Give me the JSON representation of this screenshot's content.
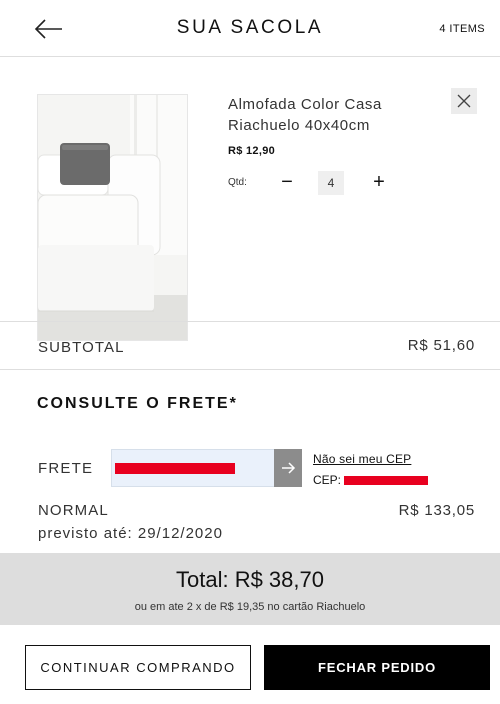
{
  "header": {
    "title": "SUA SACOLA",
    "item_count": "4 ITEMS",
    "back_icon": "arrow-left-icon"
  },
  "cart_item": {
    "name": "Almofada Color Casa Riachuelo 40x40cm",
    "price": "R$ 12,90",
    "qty_label": "Qtd:",
    "quantity": "4",
    "minus_symbol": "−",
    "plus_symbol": "+",
    "image_icon": "product-photo-sofa-with-gray-pillow",
    "remove_icon": "close-icon"
  },
  "summary": {
    "subtotal_label": "SUBTOTAL",
    "subtotal_value": "R$ 51,60"
  },
  "shipping": {
    "title": "CONSULTE O FRETE*",
    "frete_label": "FRETE",
    "dont_know_cep": "Não sei meu CEP",
    "cep_label": "CEP:",
    "method": "NORMAL",
    "method_price": "R$ 133,05",
    "forecast": "previsto até: 29/12/2020",
    "redaction_color": "#e8001f",
    "submit_icon": "arrow-right-icon"
  },
  "totals": {
    "total": "Total: R$ 38,70",
    "installments": "ou em ate 2 x de R$ 19,35 no cartão Riachuelo"
  },
  "actions": {
    "continue_label": "CONTINUAR COMPRANDO",
    "checkout_label": "FECHAR PEDIDO"
  }
}
